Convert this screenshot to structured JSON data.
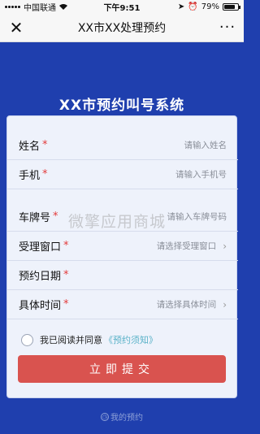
{
  "status": {
    "carrier": "中国联通",
    "time": "下午9:51",
    "battery": "79%",
    "battery_level": 0.79
  },
  "nav": {
    "close": "✕",
    "title": "XX市XX处理预约",
    "more": "···"
  },
  "system_title": "XX市预约叫号系统",
  "form": {
    "name": {
      "label": "姓名",
      "req": "*",
      "placeholder": "请输入姓名"
    },
    "phone": {
      "label": "手机",
      "req": "*",
      "placeholder": "请输入手机号"
    },
    "plate": {
      "label": "车牌号",
      "req": "*",
      "placeholder": "请输入车牌号码"
    },
    "window": {
      "label": "受理窗口",
      "req": "*",
      "placeholder": "请选择受理窗口"
    },
    "date": {
      "label": "预约日期",
      "req": "*"
    },
    "time": {
      "label": "具体时间",
      "req": "*",
      "placeholder": "请选择具体时间"
    }
  },
  "agree": {
    "text": "我已阅读并同意",
    "link": "《预约须知》"
  },
  "submit_label": "立即提交",
  "my_appointments": "我的预约",
  "watermark": "微擎应用商城"
}
